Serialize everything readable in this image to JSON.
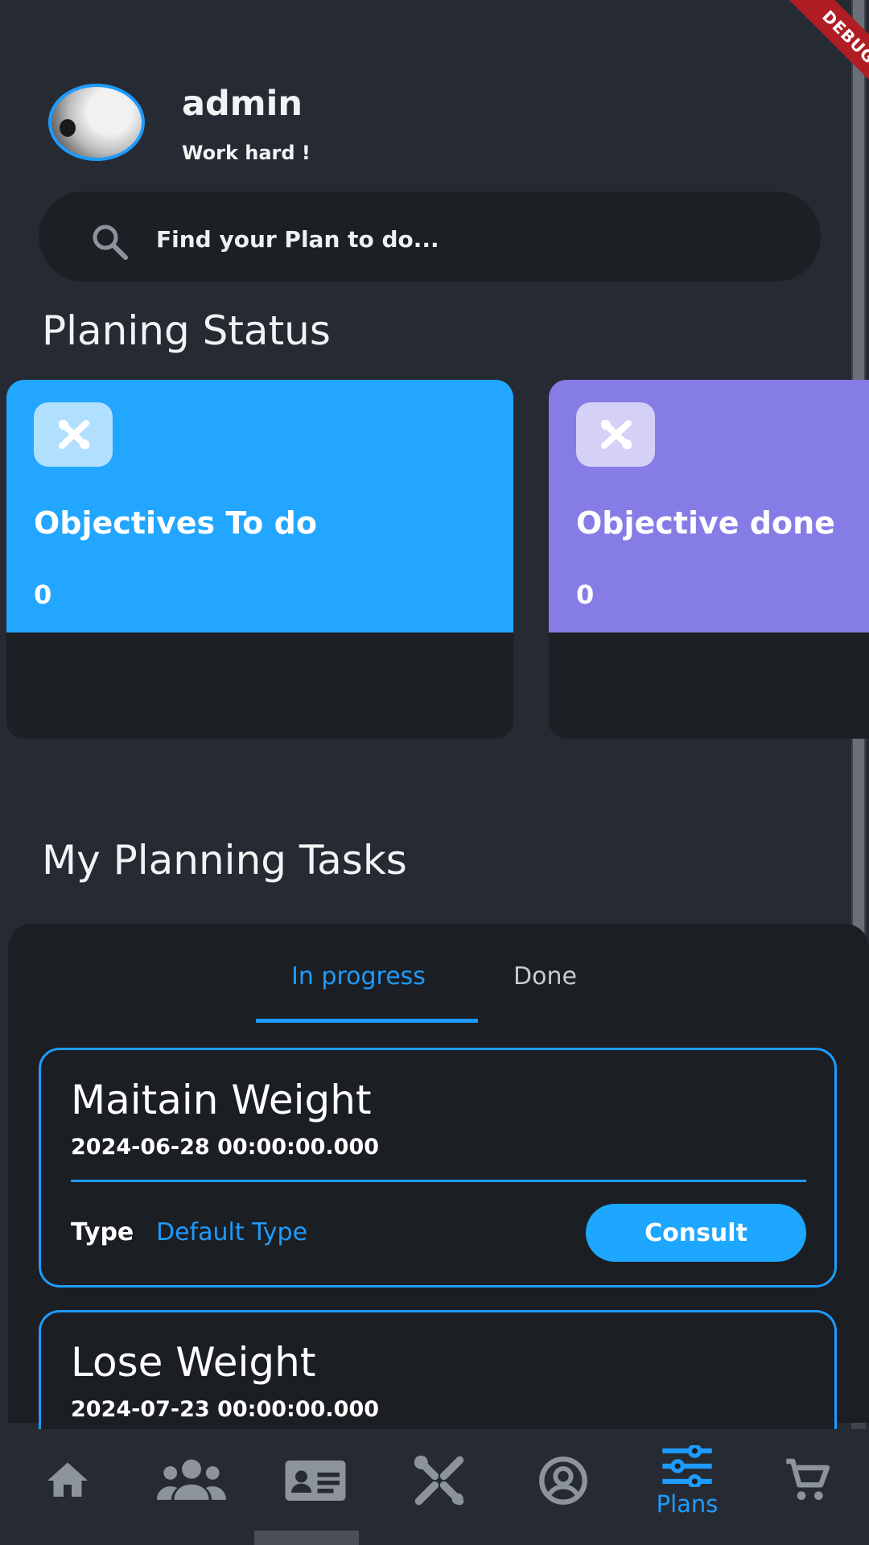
{
  "profile": {
    "username": "admin",
    "tagline": "Work hard !"
  },
  "search": {
    "placeholder": "Find your Plan to do...",
    "icon": "search-icon"
  },
  "status_section": {
    "title": "Planing Status",
    "cards": [
      {
        "label": "Objectives To do",
        "count": "0",
        "color": "#22a6ff",
        "icon": "tools-icon"
      },
      {
        "label": "Objective done",
        "count": "0",
        "color": "#867ce6",
        "icon": "tools-icon"
      }
    ]
  },
  "tasks_section": {
    "title": "My Planning Tasks",
    "tabs": [
      {
        "label": "In progress",
        "active": true
      },
      {
        "label": "Done",
        "active": false
      }
    ],
    "tasks": [
      {
        "title": "Maitain Weight",
        "date": "2024-06-28 00:00:00.000",
        "type_label": "Type",
        "type_value": "Default Type",
        "action": "Consult"
      },
      {
        "title": "Lose Weight",
        "date": "2024-07-23 00:00:00.000"
      }
    ]
  },
  "bottom_nav": {
    "items": [
      {
        "icon": "home-icon"
      },
      {
        "icon": "users-icon"
      },
      {
        "icon": "id-card-icon"
      },
      {
        "icon": "tools-icon"
      },
      {
        "icon": "account-circle-icon"
      },
      {
        "icon": "tune-icon",
        "label": "Plans",
        "active": true
      },
      {
        "icon": "cart-icon"
      }
    ]
  },
  "debug_banner": "DEBUG",
  "colors": {
    "accent": "#1e9bff",
    "background": "#262b33",
    "panel": "#1b1e23",
    "nav_icon": "#8c939d"
  }
}
